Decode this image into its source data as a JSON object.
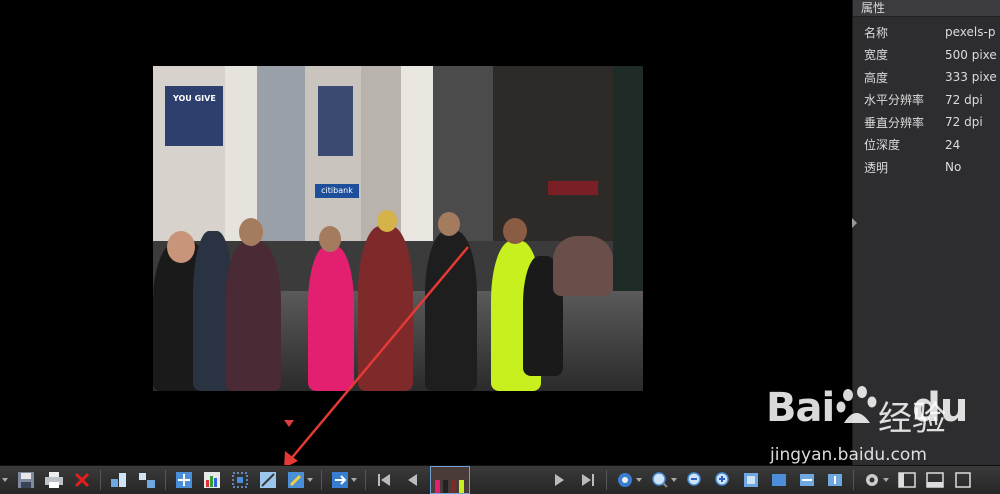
{
  "properties_panel": {
    "title": "属性",
    "rows": [
      {
        "name": "名称",
        "value": "pexels-p"
      },
      {
        "name": "宽度",
        "value": "500 pixe"
      },
      {
        "name": "高度",
        "value": "333 pixe"
      },
      {
        "name": "水平分辨率",
        "value": "72 dpi"
      },
      {
        "name": "垂直分辨率",
        "value": "72 dpi"
      },
      {
        "name": "位深度",
        "value": "24"
      },
      {
        "name": "透明",
        "value": "No"
      }
    ]
  },
  "photo_signs": {
    "bank": "citibank",
    "billboard": "YOU GIVE"
  },
  "watermark": {
    "logo": "Bai",
    "logo_tail": "du",
    "chinese": "经验",
    "url": "jingyan.baidu.com"
  },
  "toolbar_icons": [
    "save-icon",
    "print-icon",
    "delete-icon",
    "grid-icon",
    "arrange-icon",
    "move-icon",
    "chart-icon",
    "select-icon",
    "image-edit-icon",
    "pen-icon",
    "arrow-right-icon",
    "first-icon",
    "prev-icon",
    "next-icon",
    "last-icon",
    "settings-icon",
    "zoom-out-icon",
    "zoom-in-icon",
    "fit-icon",
    "actual-size-icon",
    "fit-width-icon",
    "fit-height-icon",
    "gear-icon",
    "panel-icon",
    "filmstrip-icon",
    "fullscreen-icon"
  ],
  "colors": {
    "accent": "#4a90d9",
    "annotation": "#e53935",
    "panel": "#2d2d30"
  }
}
